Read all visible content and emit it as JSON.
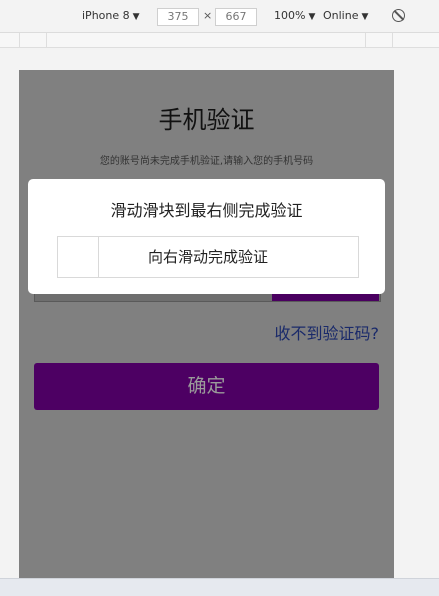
{
  "devtools": {
    "device": "iPhone 8",
    "width": "375",
    "height": "667",
    "zoom": "100%",
    "network": "Online"
  },
  "page": {
    "title": "手机验证",
    "subtitle": "您的账号尚未完成手机验证,请输入您的手机号码",
    "resend_link": "收不到验证码?",
    "confirm_label": "确定"
  },
  "modal": {
    "title": "滑动滑块到最右侧完成验证",
    "slider_text": "向右滑动完成验证",
    "slider_progress": 0
  },
  "colors": {
    "overlay": "#808080",
    "primary_button": "#4d0063",
    "link": "#1a2a6a"
  }
}
